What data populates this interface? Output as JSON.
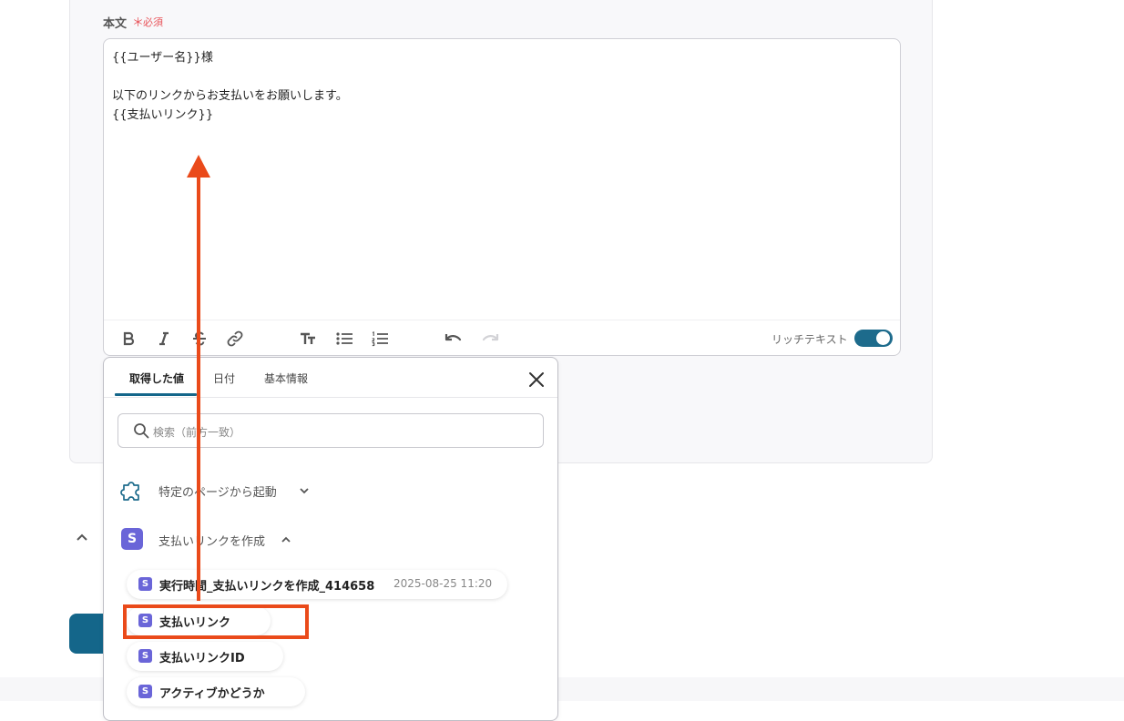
{
  "field": {
    "label": "本文",
    "required_mark": "＊",
    "required_text": "必須"
  },
  "editor": {
    "lines": [
      "{{ユーザー名}}様",
      "以下のリンクからお支払いをお願いします。",
      "{{支払いリンク}}"
    ]
  },
  "toolbar": {
    "rich_text_label": "リッチテキスト",
    "rich_text_enabled": true
  },
  "popover": {
    "tabs": [
      {
        "label": "取得した値",
        "active": true
      },
      {
        "label": "日付",
        "active": false
      },
      {
        "label": "基本情報",
        "active": false
      }
    ],
    "search_placeholder": "検索（前方一致）",
    "sections": [
      {
        "label": "特定のページから起動",
        "expanded": false
      },
      {
        "label": "支払いリンクを作成",
        "expanded": true
      }
    ],
    "items": [
      {
        "label": "実行時間_支払いリンクを作成_414658",
        "meta": "2025-08-25 11:20"
      },
      {
        "label": "支払いリンク",
        "meta": ""
      },
      {
        "label": "支払いリンクID",
        "meta": ""
      },
      {
        "label": "アクティブかどうか",
        "meta": ""
      }
    ],
    "service_badge": "S"
  },
  "colors": {
    "accent": "#14668a",
    "service": "#6a65d8",
    "annotation": "#ea4a1a",
    "required": "#e8545a"
  }
}
